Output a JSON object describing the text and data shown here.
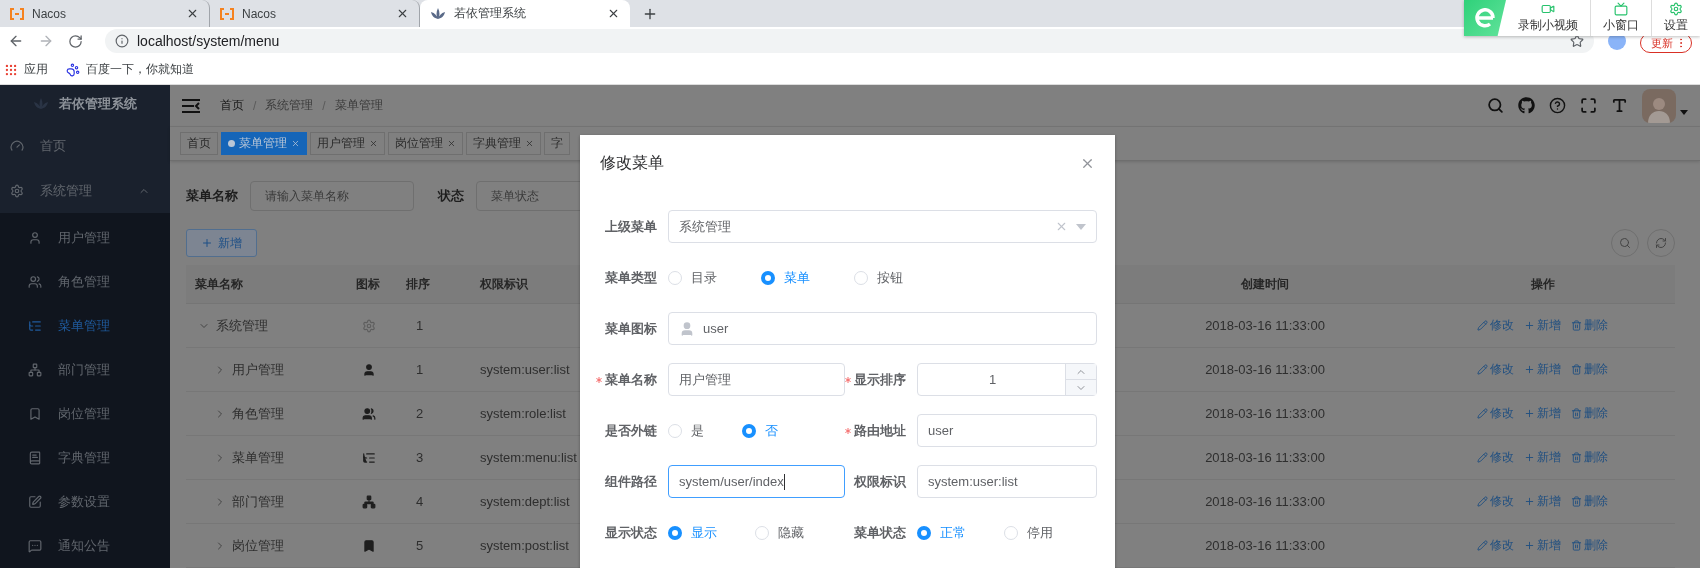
{
  "browser": {
    "tabs": [
      {
        "title": "Nacos",
        "selected": false
      },
      {
        "title": "Nacos",
        "selected": false
      },
      {
        "title": "若依管理系统",
        "selected": true
      }
    ],
    "url": "localhost/system/menu",
    "update_button": "更新",
    "bookmarks": [
      "应用",
      "百度一下，你就知道"
    ]
  },
  "overlay_toolbar": {
    "items": [
      "录制小视频",
      "小窗口",
      "设置"
    ]
  },
  "sidebar": {
    "title": "若依管理系统",
    "items": [
      {
        "label": "首页",
        "selected": false
      },
      {
        "label": "系统管理",
        "selected": false,
        "expanded": true,
        "children": [
          {
            "label": "用户管理",
            "selected": false
          },
          {
            "label": "角色管理",
            "selected": false
          },
          {
            "label": "菜单管理",
            "selected": true
          },
          {
            "label": "部门管理",
            "selected": false
          },
          {
            "label": "岗位管理",
            "selected": false
          },
          {
            "label": "字典管理",
            "selected": false
          },
          {
            "label": "参数设置",
            "selected": false
          },
          {
            "label": "通知公告",
            "selected": false
          }
        ]
      }
    ]
  },
  "navbar": {
    "breadcrumbs": [
      "首页",
      "系统管理",
      "菜单管理"
    ],
    "separator": "/"
  },
  "tags": [
    {
      "label": "首页",
      "selected": false,
      "closable": false
    },
    {
      "label": "菜单管理",
      "selected": true,
      "closable": true
    },
    {
      "label": "用户管理",
      "selected": false,
      "closable": true
    },
    {
      "label": "岗位管理",
      "selected": false,
      "closable": true
    },
    {
      "label": "字典管理",
      "selected": false,
      "closable": true
    },
    {
      "label": "字",
      "selected": false,
      "closable": false
    }
  ],
  "search": {
    "fields": [
      {
        "label": "菜单名称",
        "placeholder": "请输入菜单名称"
      },
      {
        "label": "状态",
        "placeholder": "菜单状态"
      }
    ]
  },
  "add_button": "新增",
  "table": {
    "columns": [
      "菜单名称",
      "图标",
      "排序",
      "权限标识",
      "创建时间",
      "操作"
    ],
    "rows": [
      {
        "name": "系统管理",
        "expanded": true,
        "sort": "1",
        "created": "2018-03-16 11:33:00",
        "actions": [
          "修改",
          "新增",
          "删除"
        ],
        "children": [
          {
            "name": "用户管理",
            "expanded": false,
            "sort": "1",
            "permission": "system:user:list",
            "created": "2018-03-16 11:33:00",
            "actions": [
              "修改",
              "新增",
              "删除"
            ]
          },
          {
            "name": "角色管理",
            "expanded": false,
            "sort": "2",
            "permission": "system:role:list",
            "created": "2018-03-16 11:33:00",
            "actions": [
              "修改",
              "新增",
              "删除"
            ]
          },
          {
            "name": "菜单管理",
            "expanded": false,
            "sort": "3",
            "permission": "system:menu:list",
            "created": "2018-03-16 11:33:00",
            "actions": [
              "修改",
              "新增",
              "删除"
            ]
          },
          {
            "name": "部门管理",
            "expanded": false,
            "sort": "4",
            "permission": "system:dept:list",
            "created": "2018-03-16 11:33:00",
            "actions": [
              "修改",
              "新增",
              "删除"
            ]
          },
          {
            "name": "岗位管理",
            "expanded": false,
            "sort": "5",
            "permission": "system:post:list",
            "created": "2018-03-16 11:33:00",
            "actions": [
              "修改",
              "新增",
              "删除"
            ]
          }
        ]
      }
    ]
  },
  "dialog": {
    "title": "修改菜单",
    "rows": [
      {
        "fields": [
          {
            "kind": "select",
            "label": "上级菜单",
            "required": false,
            "value": "系统管理"
          }
        ]
      },
      {
        "fields": [
          {
            "kind": "radio",
            "label": "菜单类型",
            "required": false,
            "options": [
              {
                "label": "目录",
                "selected": false
              },
              {
                "label": "菜单",
                "selected": true
              },
              {
                "label": "按钮",
                "selected": false
              }
            ]
          }
        ]
      },
      {
        "fields": [
          {
            "kind": "icon_input",
            "label": "菜单图标",
            "required": false,
            "value": "user"
          }
        ]
      },
      {
        "fields": [
          {
            "kind": "text",
            "label": "菜单名称",
            "required": true,
            "focused": false,
            "value": "用户管理"
          },
          {
            "kind": "number",
            "label": "显示排序",
            "required": true,
            "value": "1"
          }
        ]
      },
      {
        "fields": [
          {
            "kind": "radio",
            "label": "是否外链",
            "required": false,
            "options": [
              {
                "label": "是",
                "selected": false
              },
              {
                "label": "否",
                "selected": true
              }
            ]
          },
          {
            "kind": "text",
            "label": "路由地址",
            "required": true,
            "focused": false,
            "value": "user"
          }
        ]
      },
      {
        "fields": [
          {
            "kind": "text",
            "label": "组件路径",
            "required": false,
            "focused": true,
            "value": "system/user/index"
          },
          {
            "kind": "text",
            "label": "权限标识",
            "required": false,
            "focused": false,
            "value": "system:user:list"
          }
        ]
      },
      {
        "fields": [
          {
            "kind": "radio",
            "label": "显示状态",
            "required": false,
            "options": [
              {
                "label": "显示",
                "selected": true
              },
              {
                "label": "隐藏",
                "selected": false
              }
            ]
          },
          {
            "kind": "radio",
            "label": "菜单状态",
            "required": false,
            "options": [
              {
                "label": "正常",
                "selected": true
              },
              {
                "label": "停用",
                "selected": false
              }
            ]
          }
        ]
      }
    ]
  }
}
